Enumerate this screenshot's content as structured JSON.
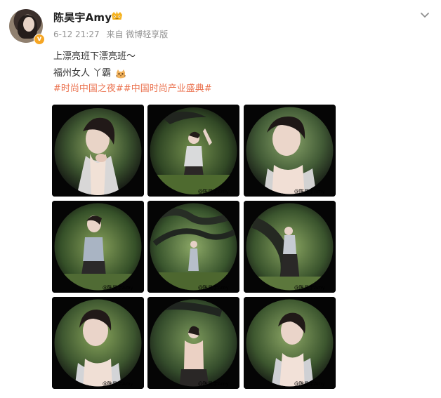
{
  "post": {
    "author": "陈昊宇Amy",
    "time": "6-12 21:27",
    "source": "来自 微博轻享版",
    "text_lines": [
      "上漂亮班下漂亮班～",
      "福州女人 丫霸"
    ],
    "hashtags": [
      "#时尚中国之夜#",
      "#中国时尚产业盛典#"
    ]
  },
  "icons": {
    "avatar": "avatar",
    "verified": "verified-icon",
    "member": "crown-cat-icon",
    "more": "chevron-down-icon",
    "emoji": "cat-emoji-icon"
  },
  "photos": {
    "watermark": "@陈昊宇Amy"
  },
  "colors": {
    "accent": "#eb7350",
    "meta": "#939393",
    "text": "#333333",
    "verified": "#f6a623"
  }
}
